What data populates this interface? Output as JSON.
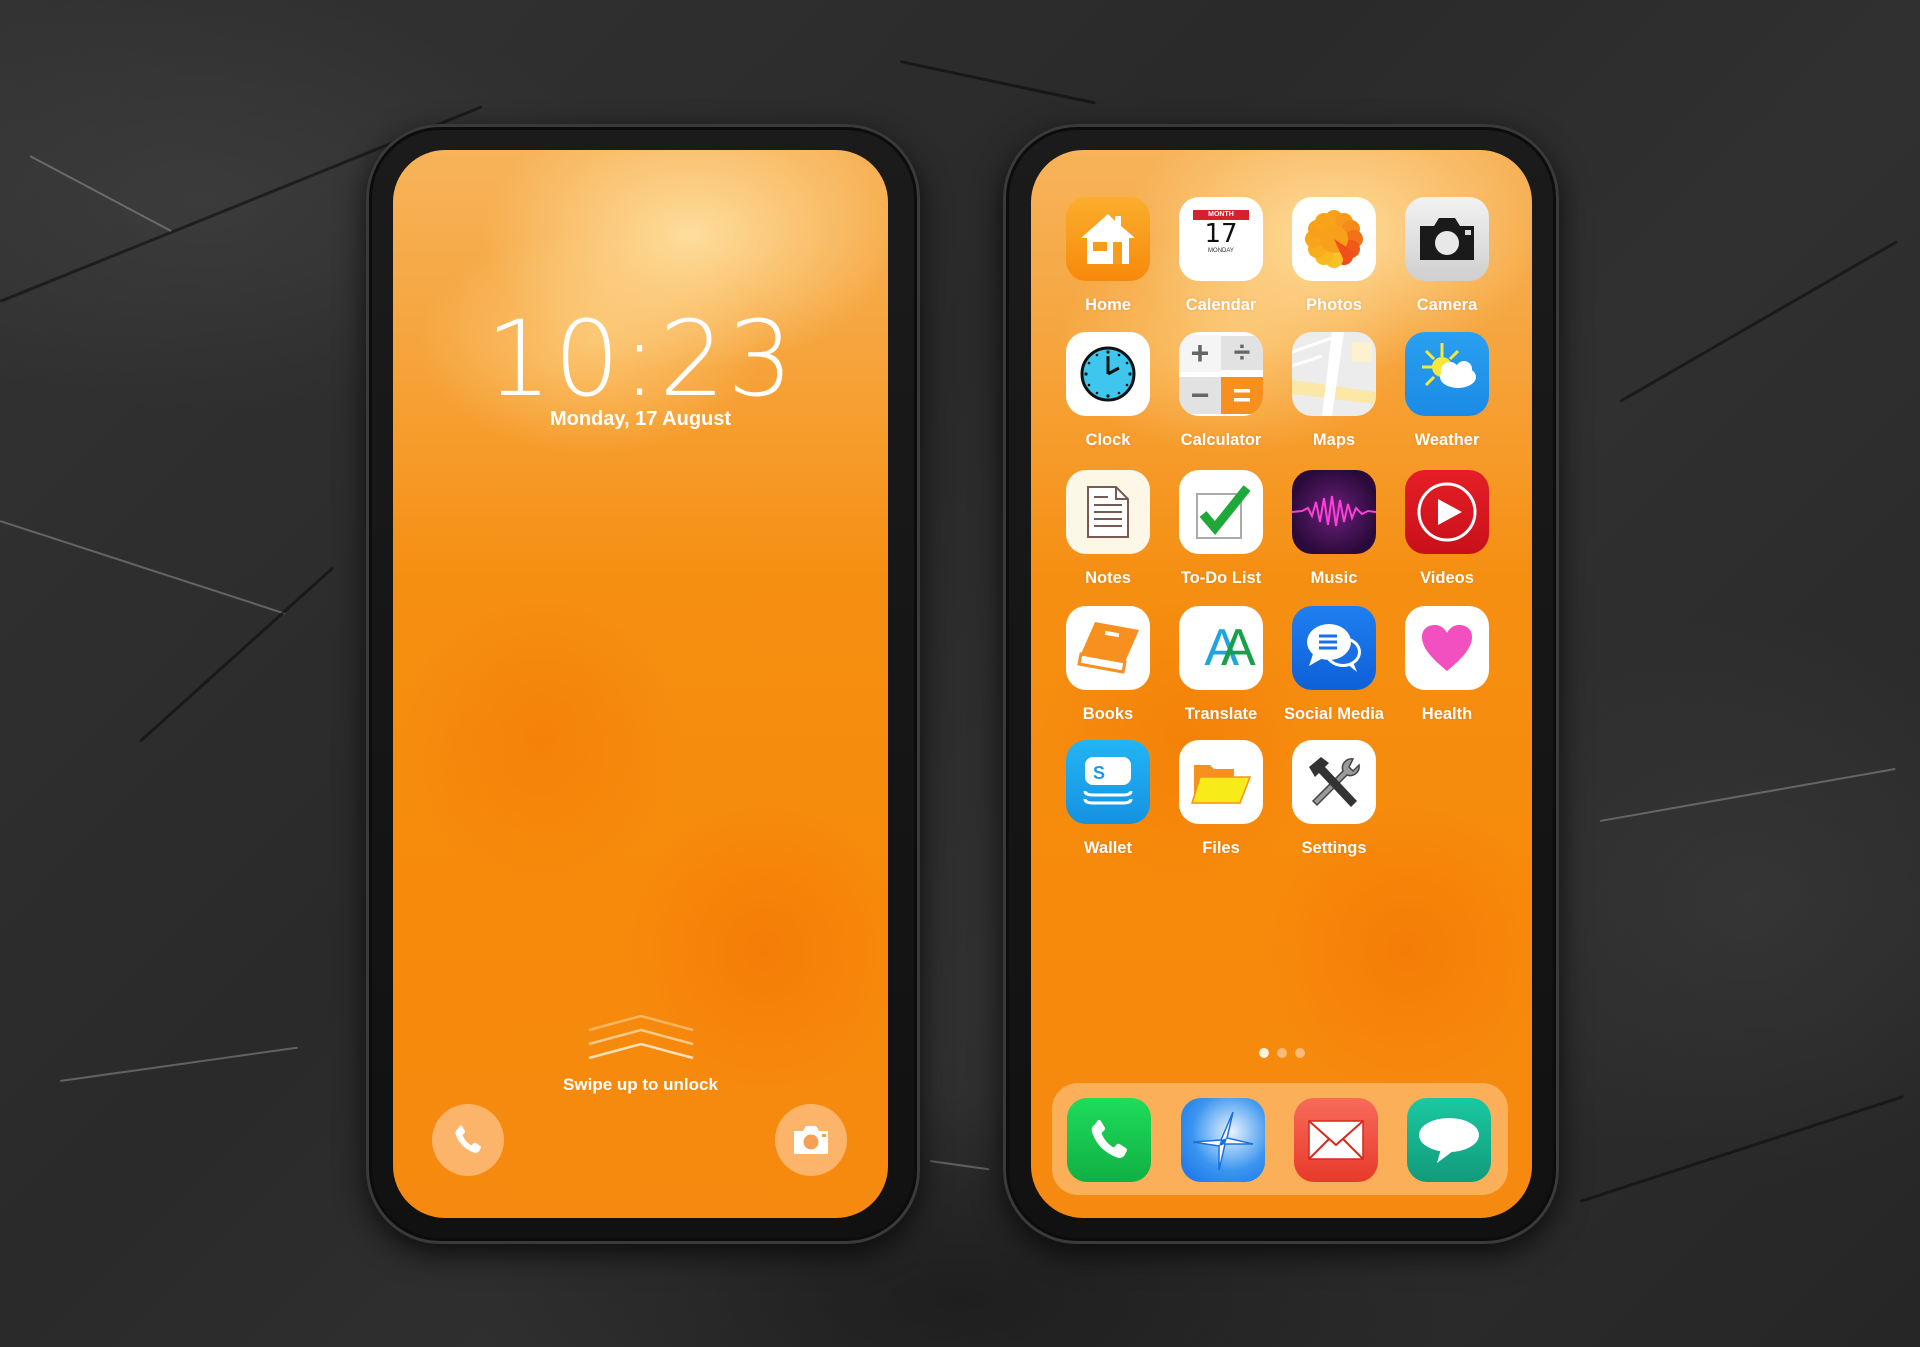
{
  "lock_screen": {
    "time": "10:23",
    "date": "Monday, 17 August",
    "unlock_hint": "Swipe up to unlock",
    "shortcuts": [
      {
        "name": "phone",
        "icon": "phone-icon"
      },
      {
        "name": "camera",
        "icon": "camera-icon"
      }
    ]
  },
  "home_screen": {
    "apps": [
      {
        "label": "Home",
        "icon": "home-icon"
      },
      {
        "label": "Calendar",
        "icon": "calendar-icon",
        "badge_month": "MONTH",
        "day": "17",
        "weekday": "MONDAY"
      },
      {
        "label": "Photos",
        "icon": "photos-icon"
      },
      {
        "label": "Camera",
        "icon": "camera-icon"
      },
      {
        "label": "Clock",
        "icon": "clock-icon"
      },
      {
        "label": "Calculator",
        "icon": "calculator-icon"
      },
      {
        "label": "Maps",
        "icon": "maps-icon"
      },
      {
        "label": "Weather",
        "icon": "weather-icon"
      },
      {
        "label": "Notes",
        "icon": "notes-icon"
      },
      {
        "label": "To-Do List",
        "icon": "checklist-icon"
      },
      {
        "label": "Music",
        "icon": "music-icon"
      },
      {
        "label": "Videos",
        "icon": "play-icon"
      },
      {
        "label": "Books",
        "icon": "book-icon"
      },
      {
        "label": "Translate",
        "icon": "translate-icon",
        "glyph": "AA"
      },
      {
        "label": "Social Media",
        "icon": "chat-bubbles-icon"
      },
      {
        "label": "Health",
        "icon": "heart-icon"
      },
      {
        "label": "Wallet",
        "icon": "wallet-icon",
        "glyph": "S"
      },
      {
        "label": "Files",
        "icon": "folder-icon"
      },
      {
        "label": "Settings",
        "icon": "tools-icon"
      }
    ],
    "page_indicator": {
      "pages": 3,
      "current": 1
    },
    "dock": [
      {
        "name": "Phone",
        "icon": "phone-icon"
      },
      {
        "name": "Safari",
        "icon": "compass-icon"
      },
      {
        "name": "Mail",
        "icon": "mail-icon"
      },
      {
        "name": "Messages",
        "icon": "message-icon"
      }
    ]
  },
  "colors": {
    "wallpaper_orange": "#f78a0a",
    "background_slate": "#2e2e2e"
  }
}
